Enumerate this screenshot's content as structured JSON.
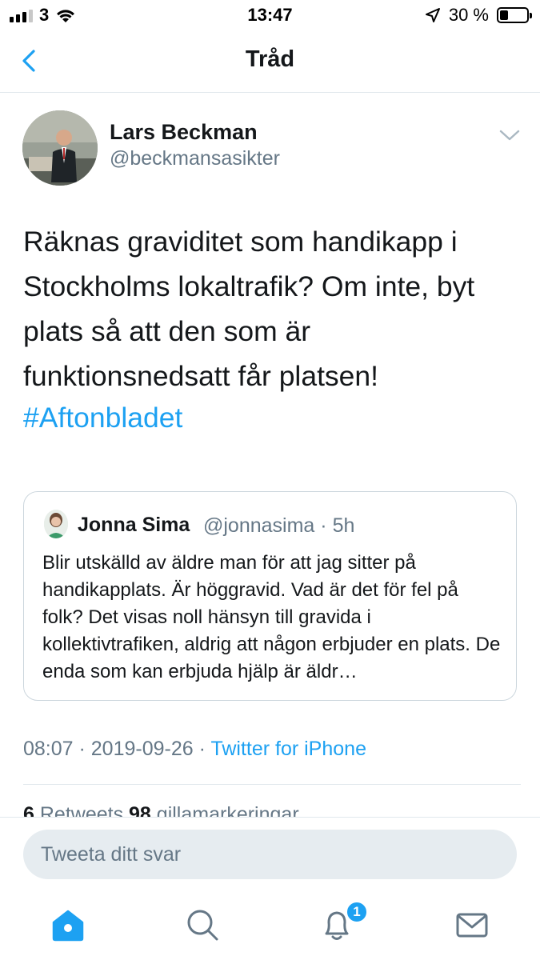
{
  "status_bar": {
    "carrier": "3",
    "time": "13:47",
    "battery_percent": "30 %",
    "battery_level": 0.3
  },
  "nav": {
    "title": "Tråd",
    "back_icon": "chevron-left-icon"
  },
  "tweet": {
    "author_name": "Lars Beckman",
    "author_handle": "@beckmansasikter",
    "text": "Räknas graviditet som handikapp i Stockholms lokaltrafik? Om inte, byt plats så att den som är funktionsnedsatt får platsen!",
    "hashtag": "#Aftonbladet",
    "time": "08:07",
    "date": "2019-09-26",
    "source": "Twitter for iPhone",
    "retweets_count": "6",
    "retweets_label": "Retweets",
    "likes_count": "98",
    "likes_label": "gillamarkeringar"
  },
  "quoted_tweet": {
    "author_name": "Jonna Sima",
    "author_handle": "@jonnasima",
    "age": "5h",
    "text": "Blir utskälld av äldre man för att jag sitter på handikapplats. Är höggravid. Vad är det för fel på folk? Det visas noll hänsyn till gravida i kollektivtrafiken, aldrig att någon erbjuder en plats. De enda som kan erbjuda hjälp är äldr…"
  },
  "reply": {
    "placeholder": "Tweeta ditt svar"
  },
  "tab_bar": {
    "items": [
      {
        "name": "home",
        "icon": "home-icon",
        "active": true
      },
      {
        "name": "search",
        "icon": "search-icon",
        "active": false
      },
      {
        "name": "notifications",
        "icon": "bell-icon",
        "active": false,
        "badge": "1"
      },
      {
        "name": "messages",
        "icon": "envelope-icon",
        "active": false
      }
    ]
  },
  "colors": {
    "accent": "#1da1f2",
    "text": "#14171a",
    "secondary": "#657786",
    "border": "#e1e8ed"
  }
}
